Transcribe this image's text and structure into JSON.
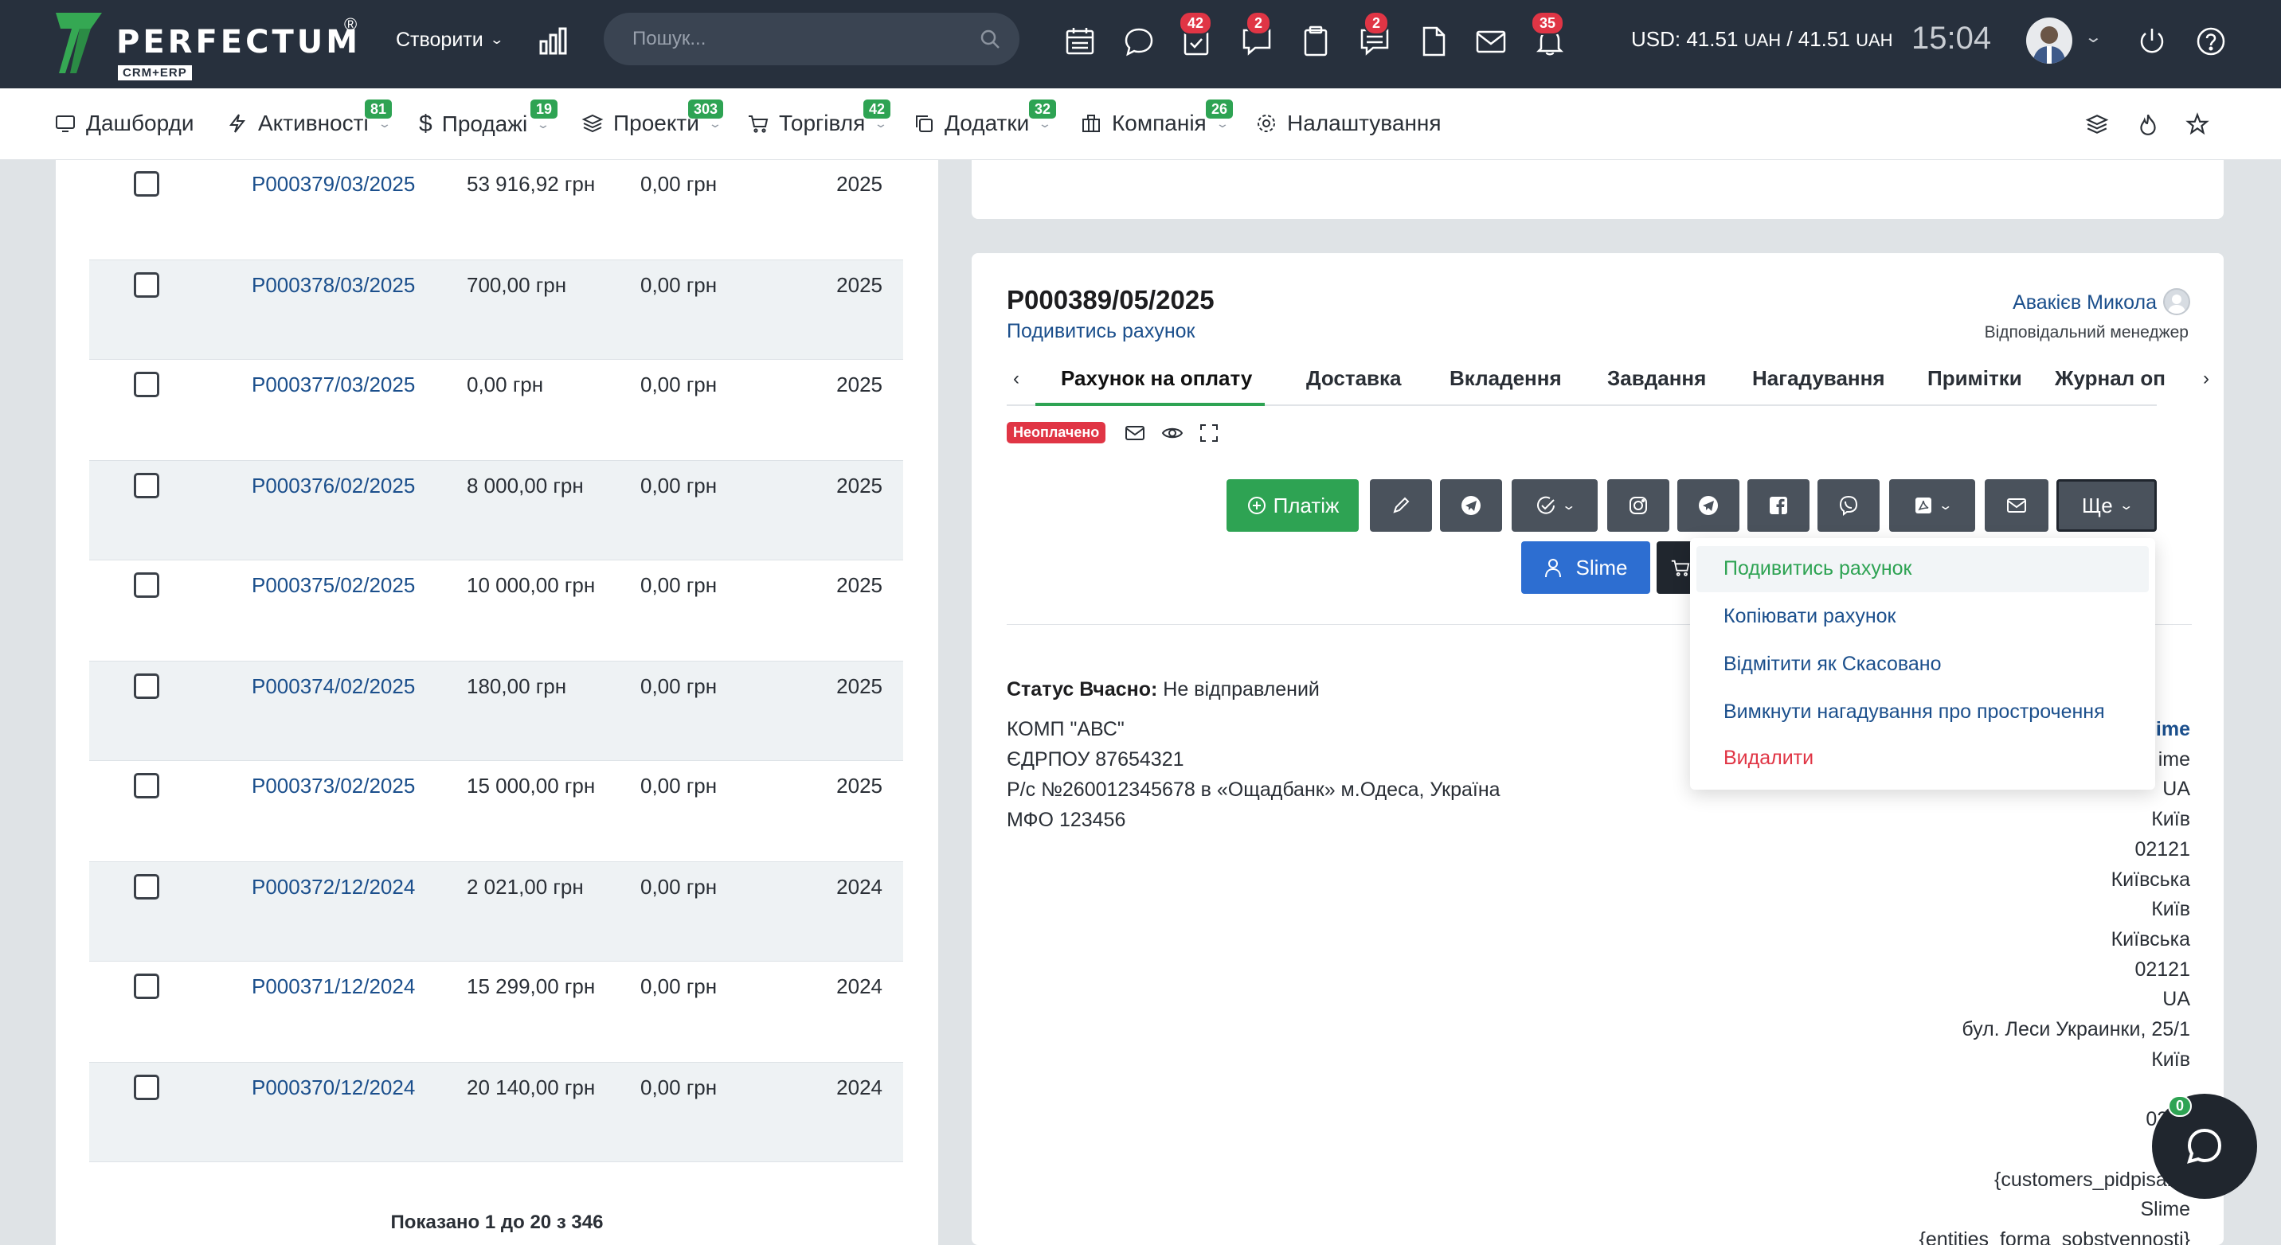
{
  "app": {
    "brand": "PERFECTUM",
    "brand_reg": "®",
    "brand_sub": "CRM+ERP",
    "create_label": "Створити",
    "search_placeholder": "Пошук...",
    "icons": [
      {
        "name": "calendar-icon"
      },
      {
        "name": "chat-bubble-icon"
      },
      {
        "name": "tasks-check-icon",
        "badge": "42"
      },
      {
        "name": "comments-icon",
        "badge": "2"
      },
      {
        "name": "clipboard-icon"
      },
      {
        "name": "notes-icon",
        "badge": "2"
      },
      {
        "name": "document-icon"
      },
      {
        "name": "mail-icon",
        "badge": "35"
      },
      {
        "name": "bell-icon"
      }
    ],
    "rate_label": "USD: 41.51",
    "rate_unit": "UAH",
    "rate_sep": " / 41.51",
    "time": "15:04"
  },
  "nav": {
    "items": [
      {
        "label": "Дашборди",
        "icon": "dashboard-icon",
        "badge": ""
      },
      {
        "label": "Активності",
        "icon": "lightning-icon",
        "badge": "81"
      },
      {
        "label": "Продажі",
        "icon": "dollar-icon",
        "badge": "19"
      },
      {
        "label": "Проекти",
        "icon": "layers-icon",
        "badge": "303"
      },
      {
        "label": "Торгівля",
        "icon": "cart-icon",
        "badge": "42"
      },
      {
        "label": "Додатки",
        "icon": "copy-icon",
        "badge": "32"
      },
      {
        "label": "Компанія",
        "icon": "building-icon",
        "badge": "26"
      },
      {
        "label": "Налаштування",
        "icon": "gear-icon",
        "badge": ""
      }
    ]
  },
  "list": {
    "rows": [
      {
        "number": "P000379/03/2025",
        "amount": "53 916,92 грн",
        "paid": "0,00 грн",
        "year": "2025"
      },
      {
        "number": "P000378/03/2025",
        "amount": "700,00 грн",
        "paid": "0,00 грн",
        "year": "2025"
      },
      {
        "number": "P000377/03/2025",
        "amount": "0,00 грн",
        "paid": "0,00 грн",
        "year": "2025"
      },
      {
        "number": "P000376/02/2025",
        "amount": "8 000,00 грн",
        "paid": "0,00 грн",
        "year": "2025"
      },
      {
        "number": "P000375/02/2025",
        "amount": "10 000,00 грн",
        "paid": "0,00 грн",
        "year": "2025"
      },
      {
        "number": "P000374/02/2025",
        "amount": "180,00 грн",
        "paid": "0,00 грн",
        "year": "2025"
      },
      {
        "number": "P000373/02/2025",
        "amount": "15 000,00 грн",
        "paid": "0,00 грн",
        "year": "2025"
      },
      {
        "number": "P000372/12/2024",
        "amount": "2 021,00 грн",
        "paid": "0,00 грн",
        "year": "2024"
      },
      {
        "number": "P000371/12/2024",
        "amount": "15 299,00 грн",
        "paid": "0,00 грн",
        "year": "2024"
      },
      {
        "number": "P000370/12/2024",
        "amount": "20 140,00 грн",
        "paid": "0,00 грн",
        "year": "2024"
      }
    ],
    "pagination": "Показано 1 до 20 з 346"
  },
  "invoice": {
    "number": "P000389/05/2025",
    "view_link": "Подивитись рахунок",
    "manager_name": "Авакієв Микола",
    "manager_role": "Відповідальний менеджер",
    "tabs": [
      "Рахунок на оплату",
      "Доставка",
      "Вкладення",
      "Завдання",
      "Нагадування",
      "Примітки",
      "Журнал оп"
    ],
    "status_badge": "Неоплачено",
    "pay_button": "Платіж",
    "more_button": "Ще",
    "client_button": "Slime",
    "status_label": "Статус Вчасно:",
    "status_value": "Не відправлений",
    "seller_lines": [
      "КОМП \"АВС\"",
      "ЄДРПОУ 87654321",
      "Р/с №260012345678 в «Ощадбанк» м.Одеса, Україна",
      "МФО 123456"
    ],
    "customer_lines": [
      "ime",
      "ime",
      "UA",
      "Київ",
      "02121",
      "Київська",
      "Київ",
      "Київська",
      "02121",
      "UA",
      "бул. Леси Украинки, 25/1",
      "Київ",
      "",
      "0200",
      "U",
      "{customers_pidpisant}",
      "Slime",
      "{entities_forma_sobstvennosti}"
    ]
  },
  "dropdown": {
    "items": [
      "Подивитись рахунок",
      "Копіювати рахунок",
      "Відмітити як Скасовано",
      "Вимкнути нагадування про прострочення",
      "Видалити"
    ]
  },
  "chat": {
    "badge": "0"
  },
  "colors": {
    "topbar": "#27303d",
    "accent_green": "#2ea353",
    "link_blue": "#1b4f8c",
    "danger": "#e03545",
    "button_dark": "#4a525c",
    "client_blue": "#2d6ed1"
  }
}
